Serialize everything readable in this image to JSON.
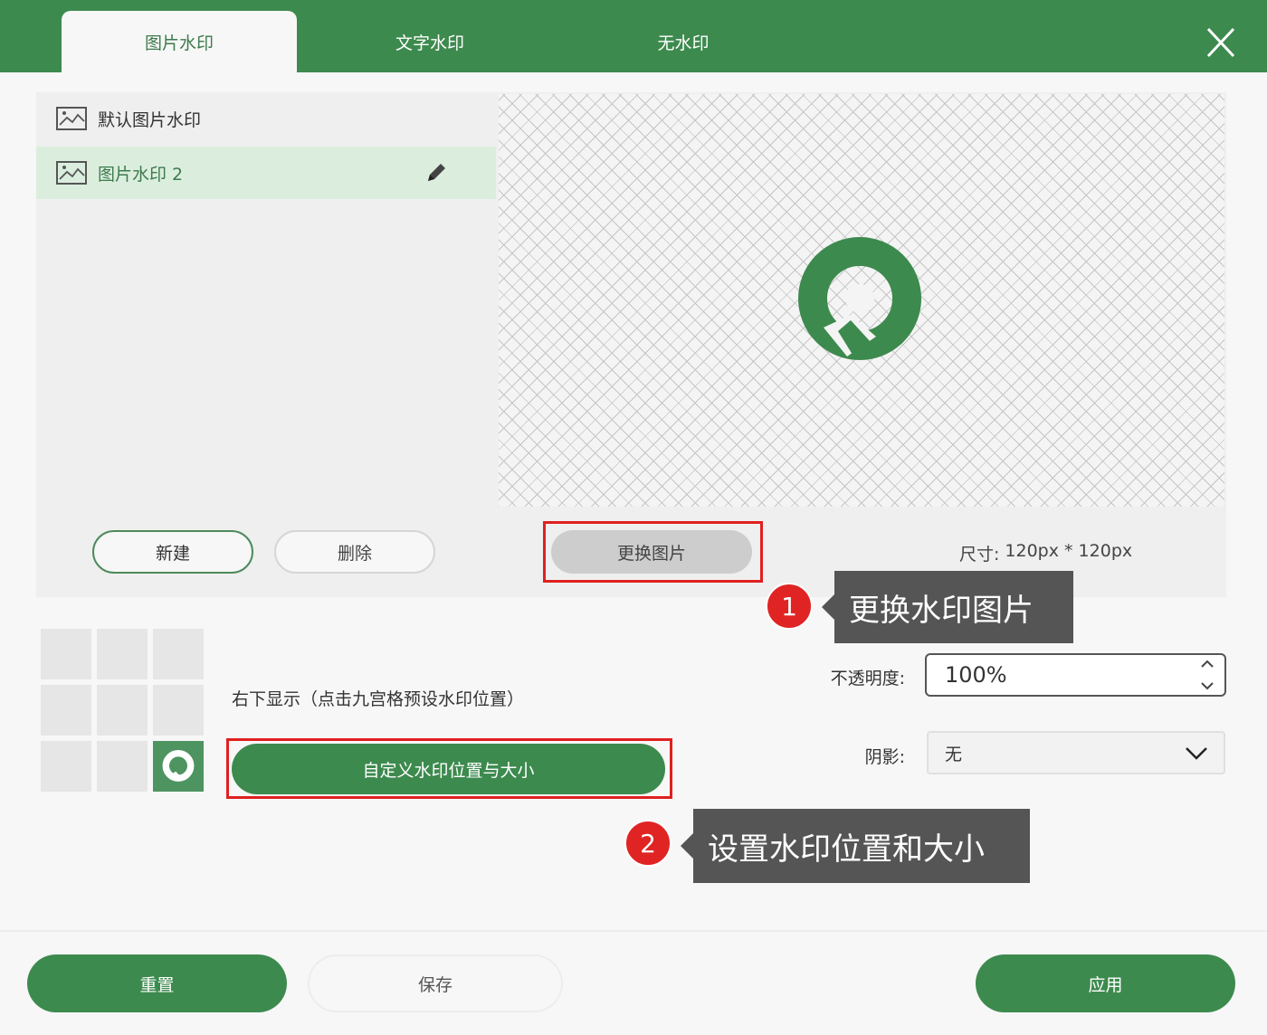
{
  "tabs": [
    {
      "label": "图片水印",
      "active": true
    },
    {
      "label": "文字水印",
      "active": false
    },
    {
      "label": "无水印",
      "active": false
    }
  ],
  "watermark_list": [
    {
      "label": "默认图片水印",
      "selected": false
    },
    {
      "label": "图片水印 2",
      "selected": true
    }
  ],
  "list_buttons": {
    "new": "新建",
    "delete": "删除"
  },
  "preview": {
    "replace_button": "更换图片",
    "size_label": "尺寸:",
    "size_value": "120px * 120px"
  },
  "callouts": [
    {
      "number": "1",
      "text": "更换水印图片"
    },
    {
      "number": "2",
      "text": "设置水印位置和大小"
    }
  ],
  "position": {
    "description": "右下显示（点击九宫格预设水印位置）",
    "selected_cell": 8,
    "custom_button": "自定义水印位置与大小"
  },
  "opacity": {
    "label": "不透明度:",
    "value": "100%"
  },
  "shadow": {
    "label": "阴影:",
    "value": "无"
  },
  "footer": {
    "reset": "重置",
    "save": "保存",
    "apply": "应用"
  },
  "colors": {
    "accent": "#3d8a4e",
    "highlight": "#e02020",
    "callout_bg": "#555555"
  }
}
